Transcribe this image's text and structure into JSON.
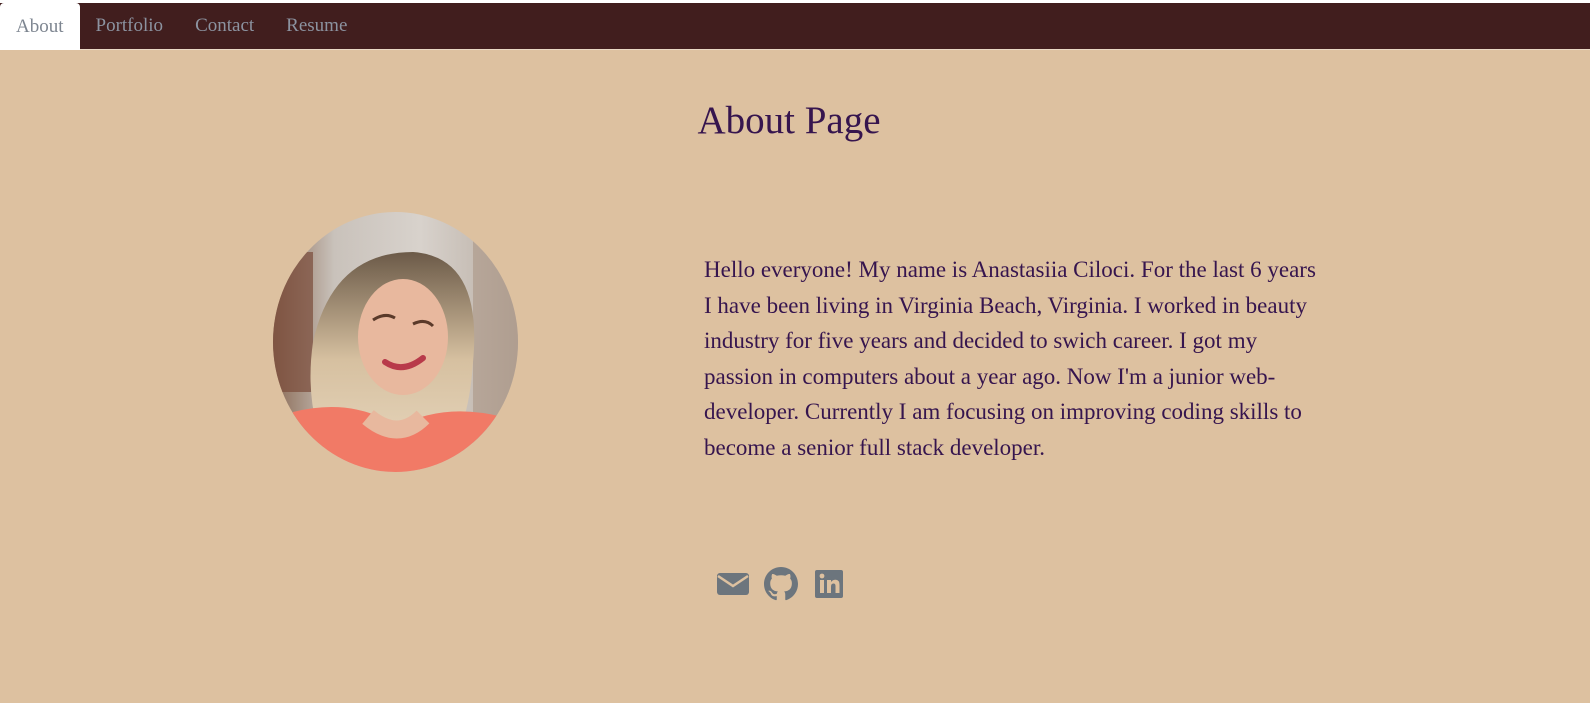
{
  "nav": {
    "tabs": [
      {
        "label": "About",
        "active": true
      },
      {
        "label": "Portfolio",
        "active": false
      },
      {
        "label": "Contact",
        "active": false
      },
      {
        "label": "Resume",
        "active": false
      }
    ]
  },
  "main": {
    "title": "About Page",
    "bio": "Hello everyone! My name is Anastasiia Ciloci. For the last 6 years I have been living in Virginia Beach, Virginia. I worked in beauty industry for five years and decided to swich career. I got my passion in computers about a year ago. Now I'm a junior web-developer. Currently I am focusing on improving coding skills to become a senior full stack developer."
  },
  "social": {
    "icons": [
      "envelope-icon",
      "github-icon",
      "linkedin-icon"
    ]
  },
  "colors": {
    "background": "#ddc1a0",
    "navbar": "#411e1e",
    "text": "#36154e",
    "icon": "#6c757d"
  }
}
